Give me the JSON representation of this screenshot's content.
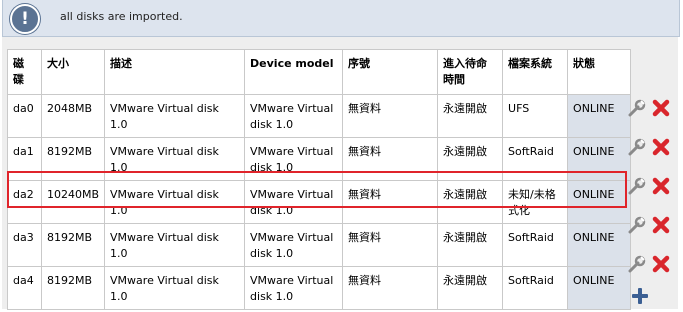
{
  "notice": {
    "icon": "info-icon",
    "message": "all disks are imported."
  },
  "table": {
    "headers": [
      "磁碟",
      "大小",
      "描述",
      "Device model",
      "序號",
      "進入待命時間",
      "檔案系統",
      "狀態"
    ],
    "rows": [
      {
        "disk": "da0",
        "size": "2048MB",
        "description": "VMware Virtual disk 1.0",
        "model": "VMware Virtual disk 1.0",
        "serial": "無資料",
        "standby": "永遠開啟",
        "fs": "UFS",
        "status": "ONLINE"
      },
      {
        "disk": "da1",
        "size": "8192MB",
        "description": "VMware Virtual disk 1.0",
        "model": "VMware Virtual disk 1.0",
        "serial": "無資料",
        "standby": "永遠開啟",
        "fs": "SoftRaid",
        "status": "ONLINE"
      },
      {
        "disk": "da2",
        "size": "10240MB",
        "description": "VMware Virtual disk 1.0",
        "model": "VMware Virtual disk 1.0",
        "serial": "無資料",
        "standby": "永遠開啟",
        "fs": "未知/未格式化",
        "status": "ONLINE"
      },
      {
        "disk": "da3",
        "size": "8192MB",
        "description": "VMware Virtual disk 1.0",
        "model": "VMware Virtual disk 1.0",
        "serial": "無資料",
        "standby": "永遠開啟",
        "fs": "SoftRaid",
        "status": "ONLINE"
      },
      {
        "disk": "da4",
        "size": "8192MB",
        "description": "VMware Virtual disk 1.0",
        "model": "VMware Virtual disk 1.0",
        "serial": "無資料",
        "standby": "永遠開啟",
        "fs": "SoftRaid",
        "status": "ONLINE"
      }
    ]
  },
  "row_actions": {
    "edit_icon": "wrench-icon",
    "delete_icon": "delete-x-icon"
  },
  "add_action": {
    "icon": "add-plus-icon"
  },
  "colors": {
    "highlight": "#e0242b",
    "status_bg": "#dbe1ea",
    "notice_bg": "#dde4ee",
    "delete_red": "#d9262c",
    "add_blue": "#3b5f93"
  }
}
